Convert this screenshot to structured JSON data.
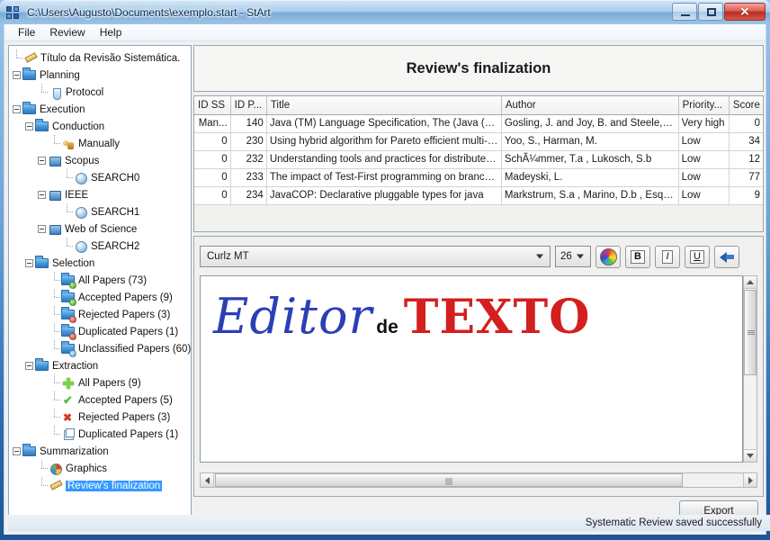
{
  "window": {
    "title": "C:\\Users\\Augusto\\Documents\\exemplo.start - StArt",
    "app_icon": "start-app-icon",
    "buttons": {
      "minimize": "minimize-icon",
      "maximize": "maximize-icon",
      "close": "✕"
    }
  },
  "menubar": {
    "items": [
      {
        "label": "File"
      },
      {
        "label": "Review"
      },
      {
        "label": "Help"
      }
    ]
  },
  "tree": {
    "nodes": [
      {
        "label": "Título da Revisão Sistemática.",
        "depth": 0,
        "icon": "pencil-icon",
        "expander": "none",
        "selected": false
      },
      {
        "label": "Planning",
        "depth": 0,
        "icon": "folder-icon",
        "expander": "minus",
        "selected": false
      },
      {
        "label": "Protocol",
        "depth": 2,
        "icon": "flask-icon",
        "expander": "none",
        "selected": false
      },
      {
        "label": "Execution",
        "depth": 0,
        "icon": "folder-icon",
        "expander": "minus",
        "selected": false
      },
      {
        "label": "Conduction",
        "depth": 1,
        "icon": "folder-edit-icon",
        "expander": "minus",
        "selected": false
      },
      {
        "label": "Manually",
        "depth": 3,
        "icon": "people-icon",
        "expander": "none",
        "selected": false
      },
      {
        "label": "Scopus",
        "depth": 2,
        "icon": "monitor-icon",
        "expander": "minus",
        "selected": false
      },
      {
        "label": "SEARCH0",
        "depth": 4,
        "icon": "disc-icon",
        "expander": "none",
        "selected": false
      },
      {
        "label": "IEEE",
        "depth": 2,
        "icon": "monitor-icon",
        "expander": "minus",
        "selected": false
      },
      {
        "label": "SEARCH1",
        "depth": 4,
        "icon": "disc-icon",
        "expander": "none",
        "selected": false
      },
      {
        "label": "Web of Science",
        "depth": 2,
        "icon": "monitor-icon",
        "expander": "minus",
        "selected": false
      },
      {
        "label": "SEARCH2",
        "depth": 4,
        "icon": "disc-icon",
        "expander": "none",
        "selected": false
      },
      {
        "label": "Selection",
        "depth": 1,
        "icon": "folder-icon",
        "expander": "minus",
        "selected": false
      },
      {
        "label": "All Papers (73)",
        "depth": 3,
        "icon": "folder-green-icon",
        "expander": "none",
        "selected": false
      },
      {
        "label": "Accepted Papers (9)",
        "depth": 3,
        "icon": "folder-green-icon",
        "expander": "none",
        "selected": false
      },
      {
        "label": "Rejected Papers (3)",
        "depth": 3,
        "icon": "folder-red-icon",
        "expander": "none",
        "selected": false
      },
      {
        "label": "Duplicated Papers (1)",
        "depth": 3,
        "icon": "folder-red-icon",
        "expander": "none",
        "selected": false
      },
      {
        "label": "Unclassified Papers (60)",
        "depth": 3,
        "icon": "folder-blue-icon",
        "expander": "none",
        "selected": false
      },
      {
        "label": "Extraction",
        "depth": 1,
        "icon": "folder-icon",
        "expander": "minus",
        "selected": false
      },
      {
        "label": "All Papers (9)",
        "depth": 3,
        "icon": "plus-icon",
        "expander": "none",
        "selected": false
      },
      {
        "label": "Accepted Papers (5)",
        "depth": 3,
        "icon": "check-icon",
        "expander": "none",
        "selected": false
      },
      {
        "label": "Rejected Papers (3)",
        "depth": 3,
        "icon": "x-icon",
        "expander": "none",
        "selected": false
      },
      {
        "label": "Duplicated Papers (1)",
        "depth": 3,
        "icon": "copy-icon",
        "expander": "none",
        "selected": false
      },
      {
        "label": "Summarization",
        "depth": 0,
        "icon": "folder-icon",
        "expander": "minus",
        "selected": false
      },
      {
        "label": "Graphics",
        "depth": 2,
        "icon": "pie-icon",
        "expander": "none",
        "selected": false
      },
      {
        "label": "Review's finalization",
        "depth": 2,
        "icon": "pencil-icon",
        "expander": "none",
        "selected": true
      }
    ]
  },
  "main": {
    "page_title": "Review's finalization",
    "table": {
      "columns": [
        "ID SS",
        "ID P...",
        "Title",
        "Author",
        "Priority...",
        "Score"
      ],
      "rows": [
        {
          "id_ss": "Man...",
          "id_p": "140",
          "title": "Java (TM) Language Specification, The (Java (Addi...",
          "author": "Gosling, J. and Joy, B. and Steele, G....",
          "priority": "Very high",
          "priority_level": "very-high",
          "score": "0"
        },
        {
          "id_ss": "0",
          "id_p": "230",
          "title": "Using hybrid algorithm for Pareto efficient multi-obj...",
          "author": "Yoo, S., Harman, M.",
          "priority": "Low",
          "priority_level": "low",
          "score": "34"
        },
        {
          "id_ss": "0",
          "id_p": "232",
          "title": "Understanding tools and practices for distributed p...",
          "author": "SchÃ¼mmer, T.a , Lukosch, S.b",
          "priority": "Low",
          "priority_level": "low",
          "score": "12"
        },
        {
          "id_ss": "0",
          "id_p": "233",
          "title": "The impact of Test-First programming on branch co...",
          "author": "Madeyski, L.",
          "priority": "Low",
          "priority_level": "low",
          "score": "77"
        },
        {
          "id_ss": "0",
          "id_p": "234",
          "title": "JavaCOP: Declarative pluggable types for java",
          "author": "Markstrum, S.a , Marino, D.b , Esquiv...",
          "priority": "Low",
          "priority_level": "low",
          "score": "9"
        }
      ]
    },
    "editor": {
      "font_name": "Curlz MT",
      "font_size": "26",
      "color_button": "color-wheel-icon",
      "bold_label": "B",
      "italic_label": "I",
      "underline_label": "U",
      "undo_icon": "undo-arrow-icon",
      "document": {
        "word1": "Editor",
        "word2": "de",
        "word3": "TEXTO"
      }
    },
    "export_button": "Export"
  },
  "statusbar": {
    "message": "Systematic Review saved successfully"
  },
  "colors": {
    "accent": "#3399ff",
    "priority_very_high": "#2e8b3d",
    "priority_low": "#8a8a2a",
    "editor_word1": "#2b3fb5",
    "editor_word3": "#d41f1f"
  }
}
